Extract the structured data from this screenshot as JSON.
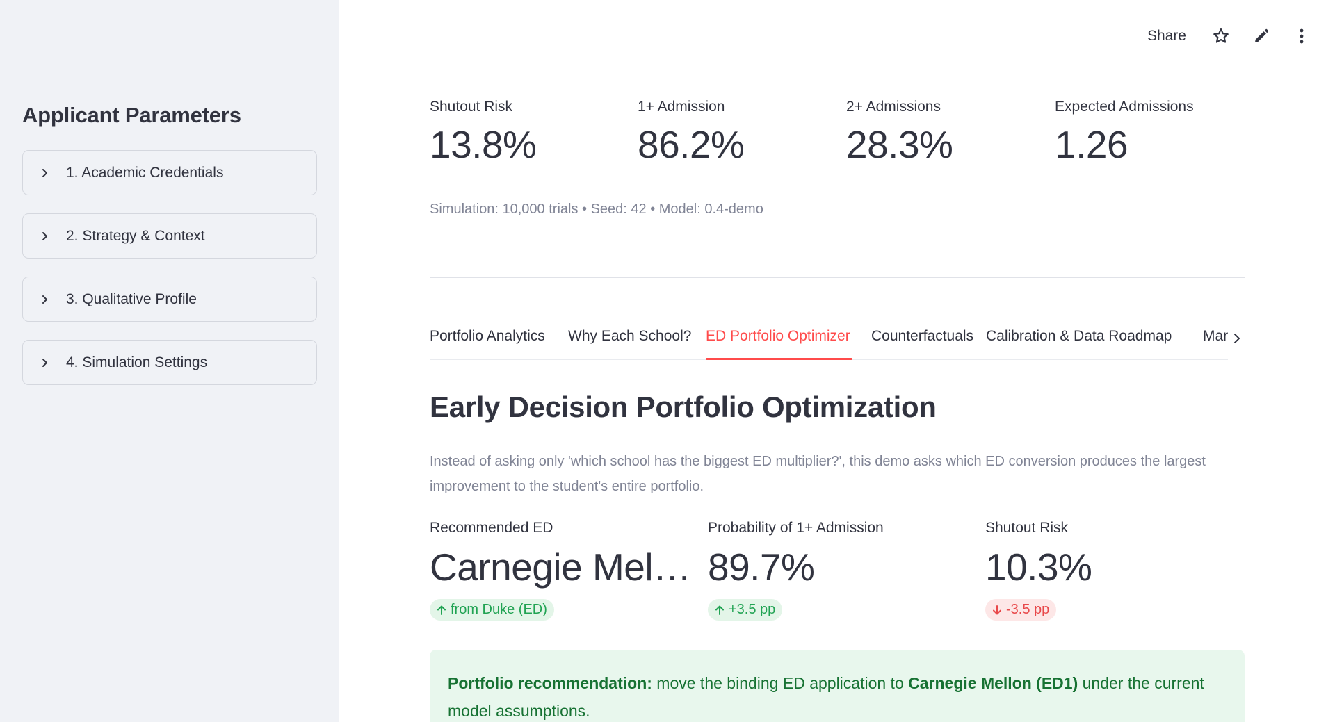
{
  "sidebar": {
    "title": "Applicant Parameters",
    "expanders": [
      {
        "label": "1. Academic Credentials"
      },
      {
        "label": "2. Strategy & Context"
      },
      {
        "label": "3. Qualitative Profile"
      },
      {
        "label": "4. Simulation Settings"
      }
    ]
  },
  "toolbar": {
    "share_label": "Share"
  },
  "top_metrics": [
    {
      "label": "Shutout Risk",
      "value": "13.8%"
    },
    {
      "label": "1+ Admission",
      "value": "86.2%"
    },
    {
      "label": "2+ Admissions",
      "value": "28.3%"
    },
    {
      "label": "Expected Admissions",
      "value": "1.26"
    }
  ],
  "caption": "Simulation: 10,000 trials • Seed: 42 • Model: 0.4-demo",
  "tabs": [
    {
      "label": "Portfolio Analytics"
    },
    {
      "label": "Why Each School?"
    },
    {
      "label": "ED Portfolio Optimizer",
      "active": true
    },
    {
      "label": "Counterfactuals"
    },
    {
      "label": "Calibration & Data Roadmap"
    },
    {
      "label": "Market"
    }
  ],
  "section": {
    "title": "Early Decision Portfolio Optimization",
    "description": "Instead of asking only 'which school has the biggest ED multiplier?', this demo asks which ED conversion produces the largest improvement to the student's entire portfolio."
  },
  "ed_metrics": [
    {
      "label": "Recommended ED",
      "value": "Carnegie Mel…",
      "delta": "from Duke (ED)",
      "direction": "up"
    },
    {
      "label": "Probability of 1+ Admission",
      "value": "89.7%",
      "delta": "+3.5 pp",
      "direction": "up"
    },
    {
      "label": "Shutout Risk",
      "value": "10.3%",
      "delta": "-3.5 pp",
      "direction": "down"
    }
  ],
  "alert": {
    "prefix_bold": "Portfolio recommendation:",
    "text1": " move the binding ED application to ",
    "school_bold": "Carnegie Mellon (ED1)",
    "text2": " under the current model assumptions."
  },
  "colors": {
    "accent": "#ff4b4b",
    "sidebar_bg": "#f0f2f6",
    "positive": "#21a353",
    "negative": "#e8484a",
    "success_bg": "#e8f7ed"
  }
}
